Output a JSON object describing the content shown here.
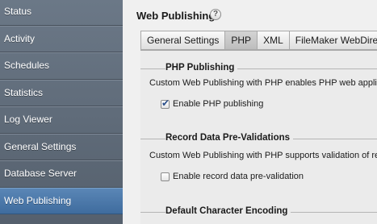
{
  "sidebar": {
    "items": [
      {
        "label": "Status"
      },
      {
        "label": "Activity"
      },
      {
        "label": "Schedules"
      },
      {
        "label": "Statistics"
      },
      {
        "label": "Log Viewer"
      },
      {
        "label": "General Settings"
      },
      {
        "label": "Database Server"
      },
      {
        "label": "Web Publishing"
      }
    ],
    "active_item": "Web Publishing"
  },
  "header": {
    "title": "Web Publishing",
    "help_icon": "?"
  },
  "tabs": [
    {
      "label": "General Settings"
    },
    {
      "label": "PHP"
    },
    {
      "label": "XML"
    },
    {
      "label": "FileMaker WebDirect"
    }
  ],
  "active_tab": "PHP",
  "sections": {
    "php": {
      "title": "PHP Publishing",
      "description": "Custom Web Publishing with PHP enables PHP web applicatio",
      "checkbox_label": "Enable PHP publishing",
      "checked": true
    },
    "validation": {
      "title": "Record Data Pre-Validations",
      "description": "Custom Web Publishing with PHP supports validation of record",
      "checkbox_label": "Enable record data pre-validation",
      "checked": false
    },
    "encoding": {
      "title": "Default Character Encoding"
    }
  },
  "colors": {
    "sidebar_bg": "#5f6b79",
    "sidebar_active": "#4a77a8",
    "checkmark": "#2a4e8a"
  }
}
